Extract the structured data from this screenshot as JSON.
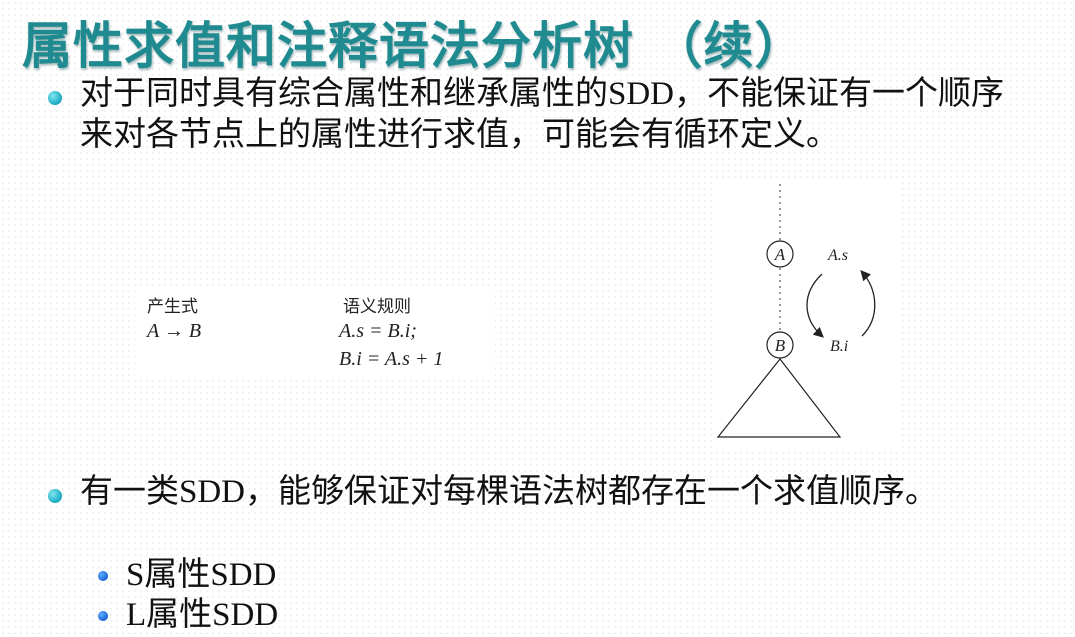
{
  "slide": {
    "title": "属性求值和注释语法分析树 （续）",
    "bullets": [
      {
        "text": "对于同时具有综合属性和继承属性的SDD，不能保证有一个顺序来对各节点上的属性进行求值，可能会有循环定义。"
      },
      {
        "text": "有一类SDD，能够保证对每棵语法树都存在一个求值顺序。",
        "subitems": [
          "S属性SDD",
          "L属性SDD"
        ]
      }
    ]
  },
  "rule_table": {
    "header_production": "产生式",
    "header_rules": "语义规则",
    "production": "A → B",
    "rule1": "A.s = B.i;",
    "rule2": "B.i = A.s + 1"
  },
  "tree_figure": {
    "node_top": "A",
    "node_bottom": "B",
    "attr_top": "A.s",
    "attr_bottom": "B.i"
  }
}
